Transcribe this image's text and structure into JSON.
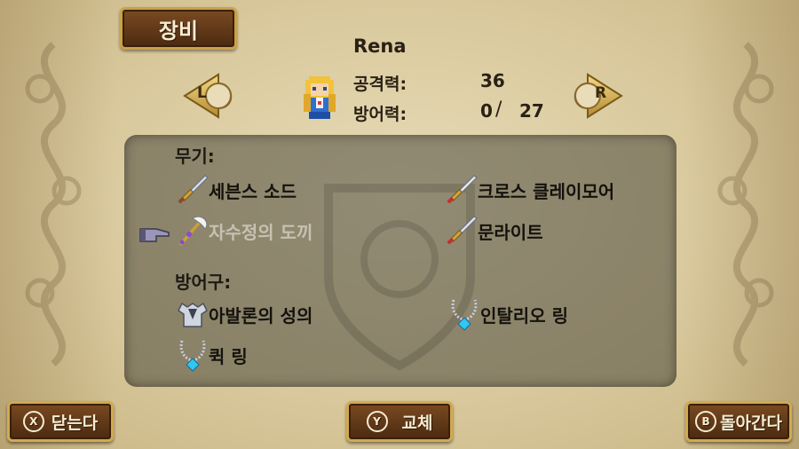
{
  "title": "장비",
  "character": {
    "name": "Rena",
    "attack_label": "공격력:",
    "attack_value": "36",
    "defense_label": "방어력:",
    "defense_current": "0",
    "defense_separator": "/",
    "defense_max": "27"
  },
  "nav": {
    "left_label": "L",
    "right_label": "R"
  },
  "weapons": {
    "title": "무기:",
    "items": [
      {
        "name": "세븐스 소드",
        "icon": "sword-icon"
      },
      {
        "name": "크로스 클레이모어",
        "icon": "sword-icon"
      },
      {
        "name": "자수정의 도끼",
        "icon": "axe-icon"
      },
      {
        "name": "문라이트",
        "icon": "sword-icon"
      }
    ]
  },
  "armor": {
    "title": "방어구:",
    "items": [
      {
        "name": "아발론의 성의",
        "icon": "armor-icon"
      },
      {
        "name": "인탈리오 링",
        "icon": "necklace-icon"
      },
      {
        "name": "퀵 링",
        "icon": "necklace-icon"
      }
    ]
  },
  "buttons": {
    "close": {
      "key": "X",
      "label": "닫는다"
    },
    "swap": {
      "key": "Y",
      "label": "교체"
    },
    "back": {
      "key": "B",
      "label": "돌아간다"
    }
  },
  "colors": {
    "frame_gold": "#d2a94f",
    "button_brown": "#5e3617",
    "parchment": "#d9c99d",
    "panel": "#4b483c"
  }
}
